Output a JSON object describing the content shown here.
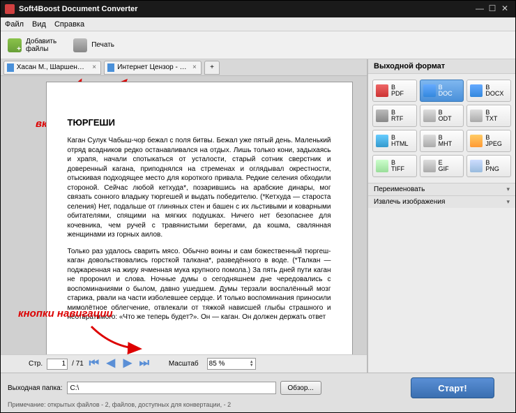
{
  "window": {
    "title": "Soft4Boost Document Converter"
  },
  "menu": {
    "file": "Файл",
    "view": "Вид",
    "help": "Справка"
  },
  "toolbar": {
    "add": "Добавить\nфайлы",
    "print": "Печать"
  },
  "tabs": [
    {
      "label": "Хасан М., Шаршеналиев ..."
    },
    {
      "label": "Интернет Цензор - эфф..."
    }
  ],
  "annotations": {
    "tabs": "вкладки",
    "nav": "кнопки навигации"
  },
  "document": {
    "title": "ТЮРГЕШИ",
    "p1": "Каган Сулук Чабыш-чор бежал с поля битвы. Бежал уже пятый день. Маленький отряд всадников редко останавливался на отдых. Лишь только кони, задыхаясь и храпя, начали спотыкаться от усталости, старый сотник сверстник и доверенный кагана, приподнялся на стременах и оглядывал окрестности, отыскивая подходящее место для короткого привала. Редкие селения обходили стороной. Сейчас любой кетхуда*, позарившись на арабские динары, мог связать сонного владыку тюргешей и выдать победителю. (*Кетхуда — староста селения) Нет, подальше от глиняных стен и башен с их льстивыми и коварными обитателями, спящими на мягких подушках. Ничего нет безопаснее для кочевника, чем ручей с травянистыми берегами, да кошма, свалянная женщинами из горных аилов.",
    "p2": "Только раз удалось сварить мясо. Обычно воины и сам божественный тюргеш-каган довольствовались горсткой талкана*, разведённого в воде. (*Талкан — поджаренная на жиру ячменная мука крупного помола.) За пять дней пути каган не проронил и слова. Ночные думы о сегодняшнем дне чередовались с воспоминаниями о былом, давно ушедшем. Думы терзали воспалённый мозг старика, рвали на части изболевшее сердце. И только воспоминания приносили мимолётное облегчение, отвлекали от тяжкой нависшей глыбы страшного и неотвратимого: «Что же теперь будет?». Он — каган. Он должен держать ответ"
  },
  "nav": {
    "page_label": "Стр.",
    "page": "1",
    "total": "/ 71",
    "zoom_label": "Масштаб",
    "zoom": "85 %"
  },
  "right": {
    "header": "Выходной формат",
    "formats": [
      {
        "k": "pdf",
        "t": "В\nPDF"
      },
      {
        "k": "doc",
        "t": "В\nDOC"
      },
      {
        "k": "docx",
        "t": "В\nDOCX"
      },
      {
        "k": "rtf",
        "t": "В\nRTF"
      },
      {
        "k": "odt",
        "t": "В\nODT"
      },
      {
        "k": "txt",
        "t": "В\nTXT"
      },
      {
        "k": "html",
        "t": "В\nHTML"
      },
      {
        "k": "mht",
        "t": "В\nMHT"
      },
      {
        "k": "jpeg",
        "t": "В\nJPEG"
      },
      {
        "k": "tiff",
        "t": "В\nTIFF"
      },
      {
        "k": "gif",
        "t": "E\nGIF"
      },
      {
        "k": "png",
        "t": "В\nPNG"
      }
    ],
    "rename": "Переименовать",
    "extract": "Извлечь изображения"
  },
  "bottom": {
    "out_label": "Выходная папка:",
    "out_path": "C:\\",
    "browse": "Обзор...",
    "start": "Старт!",
    "note": "Примечание: открытых файлов - 2, файлов, доступных для конвертации, - 2"
  }
}
